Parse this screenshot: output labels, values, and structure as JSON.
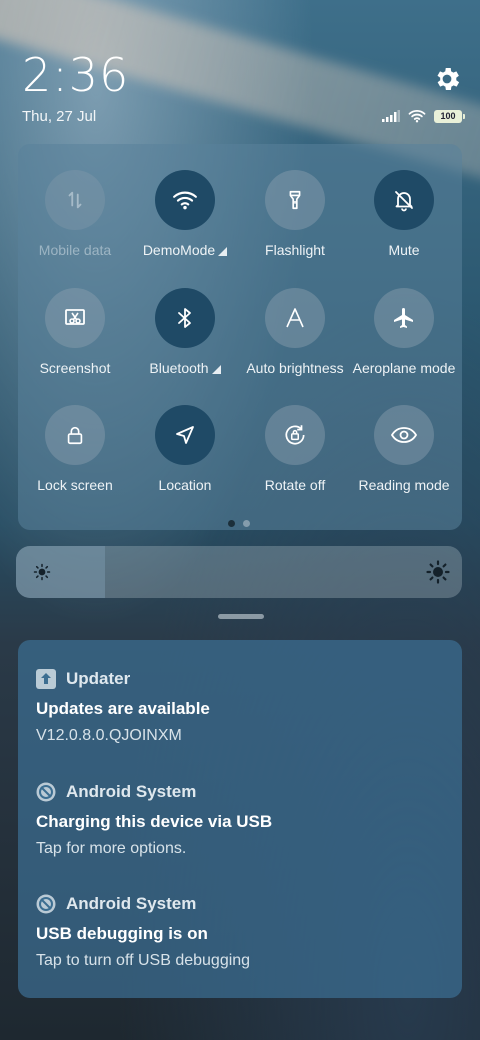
{
  "status": {
    "time": "2:36",
    "date": "Thu, 27 Jul",
    "battery": "100"
  },
  "quick_settings": {
    "tiles": [
      {
        "label": "Mobile data",
        "icon": "mobile-data-icon",
        "state": "disabled",
        "more": false
      },
      {
        "label": "DemoMode",
        "icon": "wifi-icon",
        "state": "active",
        "more": true
      },
      {
        "label": "Flashlight",
        "icon": "flashlight-icon",
        "state": "off",
        "more": false
      },
      {
        "label": "Mute",
        "icon": "bell-off-icon",
        "state": "active",
        "more": false
      },
      {
        "label": "Screenshot",
        "icon": "screenshot-icon",
        "state": "off",
        "more": false
      },
      {
        "label": "Bluetooth",
        "icon": "bluetooth-icon",
        "state": "active",
        "more": true
      },
      {
        "label": "Auto brightness",
        "icon": "auto-brightness-icon",
        "state": "off",
        "more": false
      },
      {
        "label": "Aeroplane mode",
        "icon": "airplane-icon",
        "state": "off",
        "more": false
      },
      {
        "label": "Lock screen",
        "icon": "lock-icon",
        "state": "off",
        "more": false
      },
      {
        "label": "Location",
        "icon": "location-icon",
        "state": "active",
        "more": false
      },
      {
        "label": "Rotate off",
        "icon": "rotate-lock-icon",
        "state": "off",
        "more": false
      },
      {
        "label": "Reading mode",
        "icon": "eye-icon",
        "state": "off",
        "more": false
      }
    ],
    "page_count": 2,
    "current_page": 1
  },
  "brightness": {
    "level": 0.2
  },
  "notifications": [
    {
      "app": "Updater",
      "icon": "updater-icon",
      "title": "Updates are available",
      "text": "V12.0.8.0.QJOINXM"
    },
    {
      "app": "Android System",
      "icon": "android-system-icon",
      "title": "Charging this device via USB",
      "text": "Tap for more options."
    },
    {
      "app": "Android System",
      "icon": "android-system-icon",
      "title": "USB debugging is on",
      "text": "Tap to turn off USB debugging"
    }
  ],
  "colors": {
    "active_tile": "#1f4a66",
    "panel": "#5a829b",
    "notification_panel": "#3c6e91"
  }
}
